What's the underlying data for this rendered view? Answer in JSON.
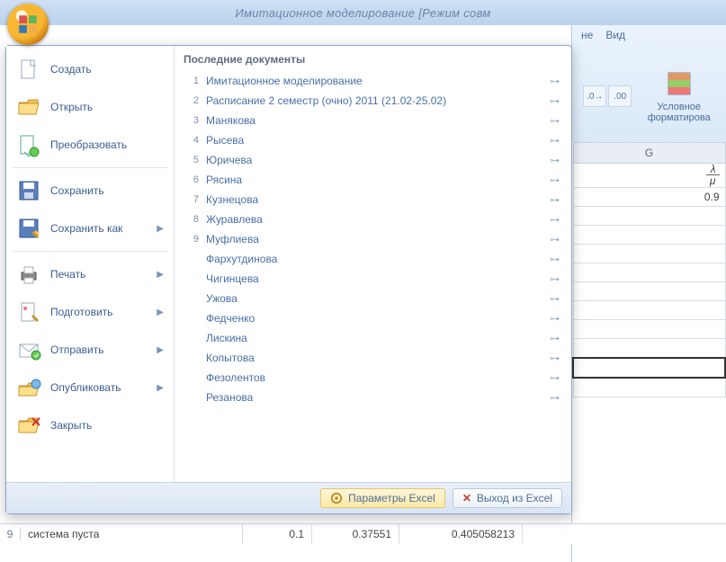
{
  "title": "Имитационное моделирование  [Режим совм",
  "ribbon": {
    "tabs": [
      "не",
      "Вид"
    ],
    "decimal_group": {
      "inc_tip": ".0 .00",
      "dec_tip": ".00 .0"
    },
    "cond_format_label": "Условное\nформатирова"
  },
  "sheet": {
    "col_header": "G",
    "fraction": {
      "num": "λ",
      "den": "μ"
    },
    "value": "0.9",
    "bottom": {
      "row": "9",
      "text": "система пуста",
      "v1": "0.1",
      "v2": "0.37551",
      "v3": "0.405058213"
    }
  },
  "office_menu": {
    "left": [
      {
        "label": "Создать",
        "icon": "new"
      },
      {
        "label": "Открыть",
        "icon": "open"
      },
      {
        "label": "Преобразовать",
        "icon": "convert"
      },
      {
        "label": "Сохранить",
        "icon": "save"
      },
      {
        "label": "Сохранить как",
        "icon": "saveas",
        "arrow": true
      },
      {
        "label": "Печать",
        "icon": "print",
        "arrow": true
      },
      {
        "label": "Подготовить",
        "icon": "prepare",
        "arrow": true
      },
      {
        "label": "Отправить",
        "icon": "send",
        "arrow": true
      },
      {
        "label": "Опубликовать",
        "icon": "publish",
        "arrow": true
      },
      {
        "label": "Закрыть",
        "icon": "close"
      }
    ],
    "recent_title": "Последние документы",
    "recent": [
      {
        "n": "1",
        "name": "Имитационное моделирование"
      },
      {
        "n": "2",
        "name": "Расписание 2 семестр (очно) 2011 (21.02-25.02)"
      },
      {
        "n": "3",
        "name": "Манякова"
      },
      {
        "n": "4",
        "name": "Рысева"
      },
      {
        "n": "5",
        "name": "Юричева"
      },
      {
        "n": "6",
        "name": "Рясина"
      },
      {
        "n": "7",
        "name": "Кузнецова"
      },
      {
        "n": "8",
        "name": "Журавлева"
      },
      {
        "n": "9",
        "name": "Муфлиева"
      },
      {
        "n": "",
        "name": "Фархутдинова"
      },
      {
        "n": "",
        "name": "Чигинцева"
      },
      {
        "n": "",
        "name": "Ужова"
      },
      {
        "n": "",
        "name": "Федченко"
      },
      {
        "n": "",
        "name": "Лискина"
      },
      {
        "n": "",
        "name": "Копытова"
      },
      {
        "n": "",
        "name": "Фезолентов"
      },
      {
        "n": "",
        "name": "Резанова"
      }
    ],
    "footer": {
      "options": "Параметры Excel",
      "exit": "Выход из Excel"
    }
  }
}
